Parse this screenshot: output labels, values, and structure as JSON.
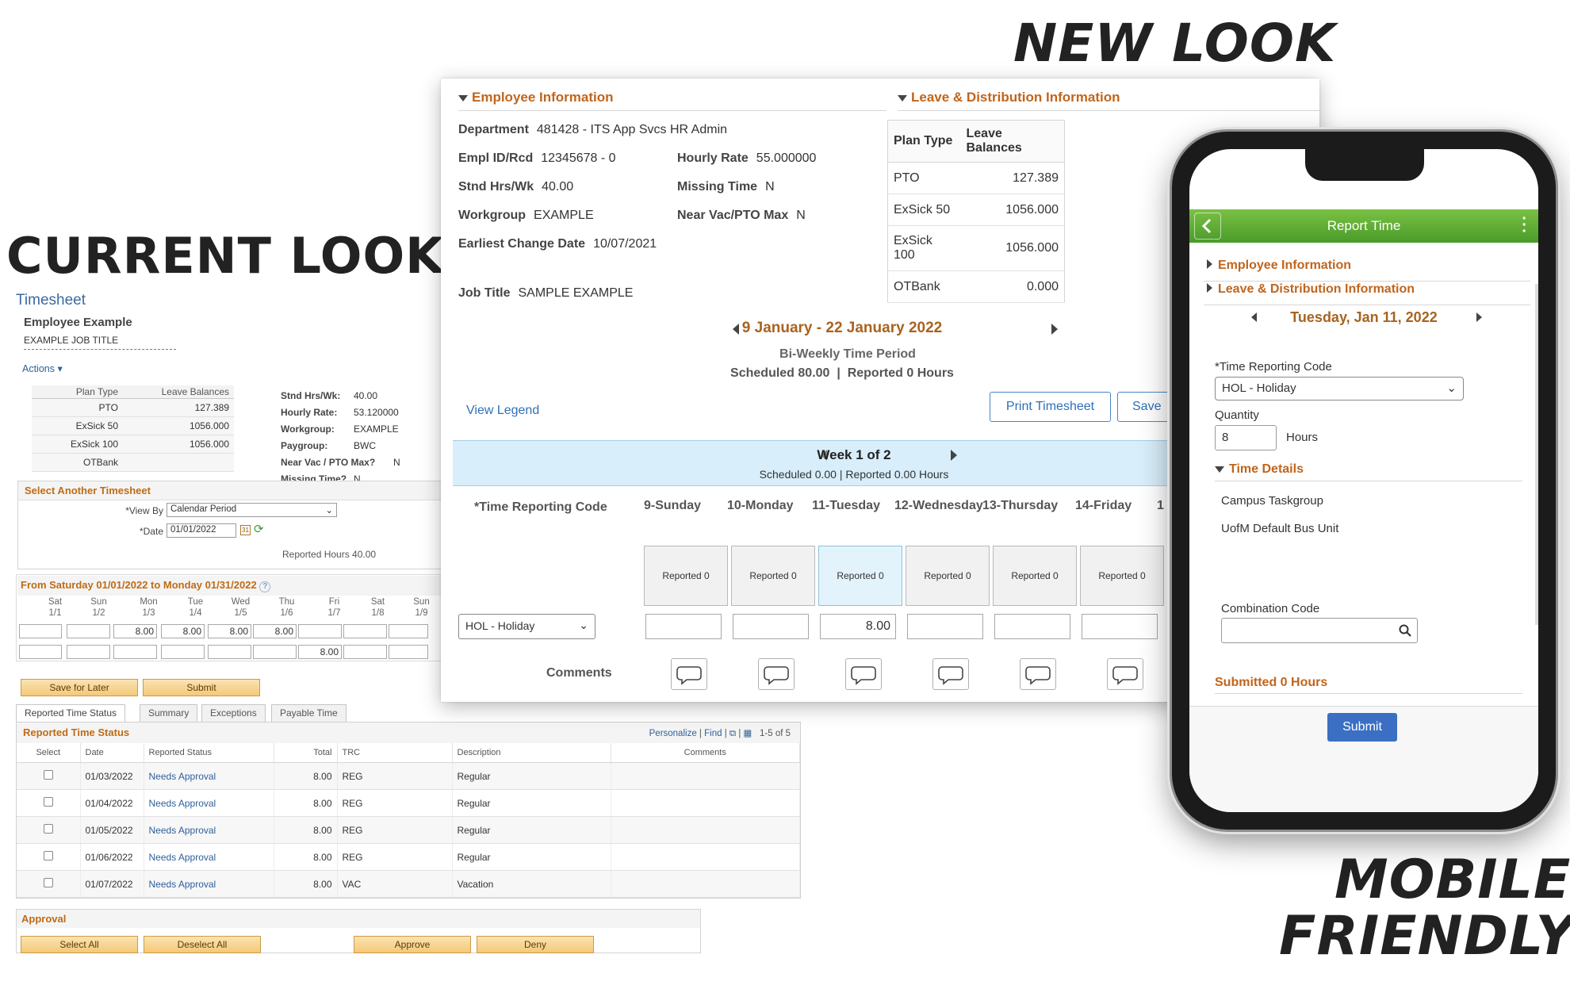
{
  "headings": {
    "new_look": "NEW LOOK",
    "current_look": "CURRENT LOOK",
    "mobile_line1": "MOBILE",
    "mobile_line2": "FRIENDLY"
  },
  "old": {
    "title": "Timesheet",
    "employee": "Employee Example",
    "job_title": "EXAMPLE JOB TITLE",
    "actions": "Actions",
    "leave": {
      "col_plan": "Plan Type",
      "col_bal": "Leave Balances",
      "rows": [
        {
          "plan": "PTO",
          "bal": "127.389"
        },
        {
          "plan": "ExSick 50",
          "bal": "1056.000"
        },
        {
          "plan": "ExSick 100",
          "bal": "1056.000"
        },
        {
          "plan": "OTBank",
          "bal": ""
        }
      ]
    },
    "info": [
      {
        "k": "Stnd Hrs/Wk:",
        "v": "40.00"
      },
      {
        "k": "Hourly Rate:",
        "v": "53.120000"
      },
      {
        "k": "Workgroup:",
        "v": "EXAMPLE"
      },
      {
        "k": "Paygroup:",
        "v": "BWC"
      },
      {
        "k": "Near Vac / PTO Max?",
        "v": "N"
      },
      {
        "k": "Missing Time?",
        "v": "N"
      }
    ],
    "select_another": "Select Another Timesheet",
    "view_by_label": "*View By",
    "view_by_value": "Calendar Period",
    "date_label": "*Date",
    "date_value": "01/01/2022",
    "reported_hours": "Reported Hours  40.00",
    "period_header": "From Saturday 01/01/2022 to Monday 01/31/2022",
    "days": [
      {
        "d": "Sat",
        "n": "1/1"
      },
      {
        "d": "Sun",
        "n": "1/2"
      },
      {
        "d": "Mon",
        "n": "1/3"
      },
      {
        "d": "Tue",
        "n": "1/4"
      },
      {
        "d": "Wed",
        "n": "1/5"
      },
      {
        "d": "Thu",
        "n": "1/6"
      },
      {
        "d": "Fri",
        "n": "1/7"
      },
      {
        "d": "Sat",
        "n": "1/8"
      },
      {
        "d": "Sun",
        "n": "1/9"
      }
    ],
    "row1": [
      "",
      "",
      "8.00",
      "8.00",
      "8.00",
      "8.00",
      "",
      "",
      ""
    ],
    "row2": [
      "",
      "",
      "",
      "",
      "",
      "",
      "8.00",
      "",
      ""
    ],
    "save_later": "Save for Later",
    "submit": "Submit",
    "tabs": [
      "Reported Time Status",
      "Summary",
      "Exceptions",
      "Payable Time"
    ],
    "grid_title": "Reported Time Status",
    "grid_tools": {
      "personalize": "Personalize",
      "find": "Find",
      "count": "1-5 of 5"
    },
    "grid_cols": [
      "Select",
      "Date",
      "Reported Status",
      "Total",
      "TRC",
      "Description",
      "Comments"
    ],
    "grid_rows": [
      {
        "date": "01/03/2022",
        "status": "Needs Approval",
        "total": "8.00",
        "trc": "REG",
        "desc": "Regular"
      },
      {
        "date": "01/04/2022",
        "status": "Needs Approval",
        "total": "8.00",
        "trc": "REG",
        "desc": "Regular"
      },
      {
        "date": "01/05/2022",
        "status": "Needs Approval",
        "total": "8.00",
        "trc": "REG",
        "desc": "Regular"
      },
      {
        "date": "01/06/2022",
        "status": "Needs Approval",
        "total": "8.00",
        "trc": "REG",
        "desc": "Regular"
      },
      {
        "date": "01/07/2022",
        "status": "Needs Approval",
        "total": "8.00",
        "trc": "VAC",
        "desc": "Vacation"
      }
    ],
    "approval": "Approval",
    "approval_buttons": [
      "Select All",
      "Deselect All",
      "Approve",
      "Deny"
    ]
  },
  "new": {
    "emp_info": "Employee Information",
    "leave_info": "Leave & Distribution Information",
    "department": {
      "k": "Department",
      "v": "481428 - ITS App Svcs HR Admin"
    },
    "empl_id": {
      "k": "Empl ID/Rcd",
      "v": "12345678  - 0"
    },
    "hourly_rate": {
      "k": "Hourly Rate",
      "v": "55.000000"
    },
    "stnd": {
      "k": "Stnd Hrs/Wk",
      "v": "40.00"
    },
    "missing": {
      "k": "Missing Time",
      "v": "N"
    },
    "workgroup": {
      "k": "Workgroup",
      "v": "EXAMPLE"
    },
    "near_vac": {
      "k": "Near Vac/PTO Max",
      "v": "N"
    },
    "earliest": {
      "k": "Earliest Change Date",
      "v": "10/07/2021"
    },
    "job_title": {
      "k": "Job Title",
      "v": "SAMPLE EXAMPLE"
    },
    "leave": {
      "col_plan": "Plan Type",
      "col_bal": "Leave Balances",
      "rows": [
        {
          "plan": "PTO",
          "bal": "127.389"
        },
        {
          "plan": "ExSick 50",
          "bal": "1056.000"
        },
        {
          "plan": "ExSick 100",
          "bal": "1056.000"
        },
        {
          "plan": "OTBank",
          "bal": "0.000"
        }
      ]
    },
    "period": "9 January - 22 January 2022",
    "period_type": "Bi-Weekly Time Period",
    "scheduled": "Scheduled  80.00",
    "reported": "Reported  0 Hours",
    "view_legend": "View Legend",
    "print": "Print Timesheet",
    "save": "Save",
    "week": "Week 1 of 2",
    "week_sub": "Scheduled  0.00 | Reported  0.00 Hours",
    "trc_label": "*Time Reporting Code",
    "days": [
      "9-Sunday",
      "10-Monday",
      "11-Tuesday",
      "12-Wednesday",
      "13-Thursday",
      "14-Friday",
      "1"
    ],
    "reported_label": "Reported   0",
    "trc_value": "HOL - Holiday",
    "hours": [
      "",
      "",
      "8.00",
      "",
      "",
      ""
    ],
    "comments": "Comments"
  },
  "mobile": {
    "title": "Report Time",
    "emp_info": "Employee Information",
    "leave_info": "Leave & Distribution Information",
    "date": "Tuesday, Jan 11, 2022",
    "trc_label": "*Time Reporting Code",
    "trc_value": "HOL - Holiday",
    "qty_label": "Quantity",
    "qty_value": "8",
    "hours": "Hours",
    "time_details": "Time Details",
    "detail1": "Campus Taskgroup",
    "detail2": "UofM Default Bus Unit",
    "combo_label": "Combination Code",
    "submitted": "Submitted 0 Hours",
    "submit": "Submit"
  },
  "colors": {
    "accent_orange": "#c0651d",
    "link_blue": "#2f6fb8",
    "mobile_green": "#5aab33",
    "submit_blue": "#3a6fc4"
  }
}
